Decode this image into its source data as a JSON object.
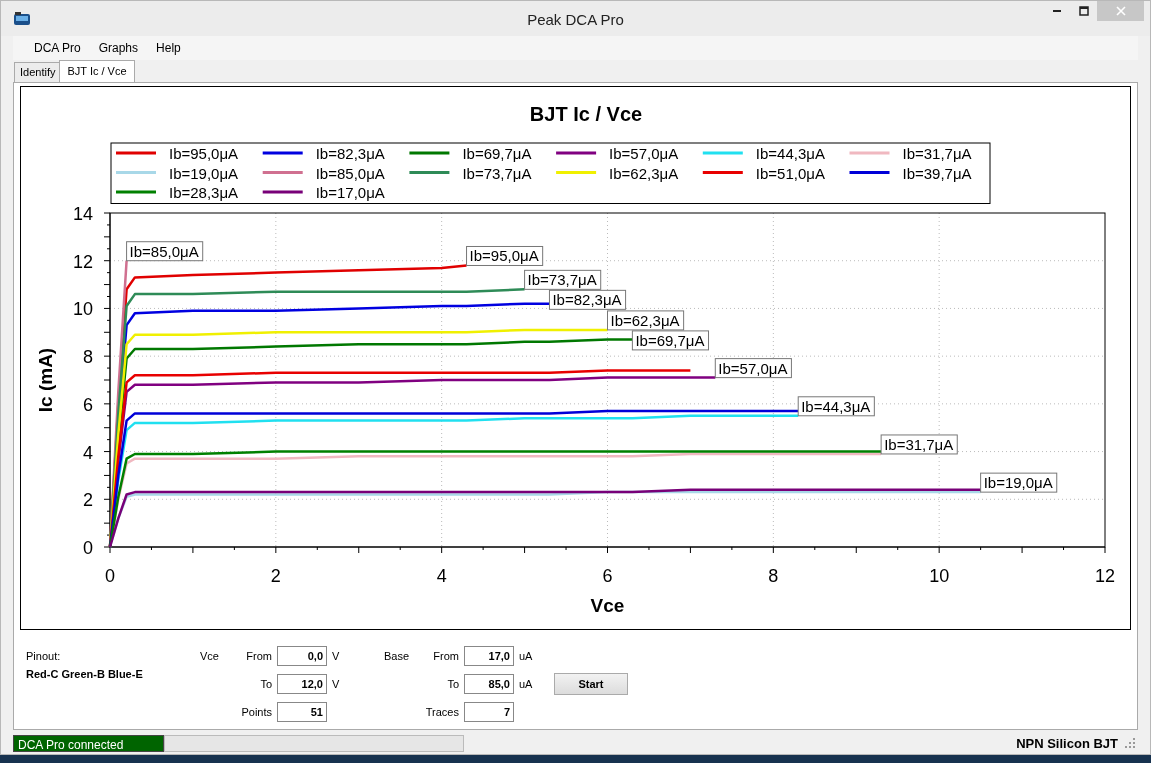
{
  "window": {
    "title": "Peak DCA Pro"
  },
  "menu": [
    "DCA Pro",
    "Graphs",
    "Help"
  ],
  "tabs": [
    {
      "label": "Identify",
      "selected": false
    },
    {
      "label": "BJT Ic / Vce",
      "selected": true
    }
  ],
  "chart": {
    "chart_data": {
      "type": "line",
      "title": "BJT Ic / Vce",
      "xlabel": "Vce",
      "ylabel": "Ic (mA)",
      "x": [
        0,
        0.1,
        0.2,
        0.3,
        1,
        2,
        3,
        4,
        4.3,
        5,
        5.3,
        6,
        6.3,
        7,
        7.3,
        8,
        8.3,
        9,
        9.3,
        10,
        10.5
      ],
      "grid": true,
      "legend": true,
      "xlim": [
        0,
        12
      ],
      "ylim": [
        0,
        14
      ],
      "xticks": [
        0,
        2,
        4,
        6,
        8,
        10,
        12
      ],
      "yticks": [
        0,
        2,
        4,
        6,
        8,
        10,
        12,
        14
      ],
      "series": [
        {
          "name": "Ib=95,0μA",
          "color": "#e00000",
          "values": [
            0,
            6.0,
            10.8,
            11.3,
            11.4,
            11.5,
            11.6,
            11.7,
            11.8,
            null,
            null,
            null,
            null,
            null,
            null,
            null,
            null,
            null,
            null,
            null,
            null
          ]
        },
        {
          "name": "Ib=82,3μA",
          "color": "#0000e0",
          "values": [
            0,
            5.2,
            9.3,
            9.8,
            9.9,
            9.9,
            10.0,
            10.1,
            10.1,
            10.2,
            10.2,
            null,
            null,
            null,
            null,
            null,
            null,
            null,
            null,
            null,
            null
          ]
        },
        {
          "name": "Ib=69,7μA",
          "color": "#007800",
          "values": [
            0,
            4.4,
            7.9,
            8.3,
            8.3,
            8.4,
            8.5,
            8.5,
            8.5,
            8.6,
            8.6,
            8.7,
            8.7,
            null,
            null,
            null,
            null,
            null,
            null,
            null,
            null
          ]
        },
        {
          "name": "Ib=57,0μA",
          "color": "#800080",
          "values": [
            0,
            3.6,
            6.5,
            6.8,
            6.8,
            6.9,
            6.9,
            7.0,
            7.0,
            7.0,
            7.0,
            7.1,
            7.1,
            7.1,
            7.1,
            null,
            null,
            null,
            null,
            null,
            null
          ]
        },
        {
          "name": "Ib=44,3μA",
          "color": "#20e0f0",
          "values": [
            0,
            2.8,
            4.9,
            5.2,
            5.2,
            5.3,
            5.3,
            5.3,
            5.3,
            5.4,
            5.4,
            5.4,
            5.4,
            5.5,
            5.5,
            5.5,
            5.5,
            null,
            null,
            null,
            null
          ]
        },
        {
          "name": "Ib=31,7μA",
          "color": "#f0b8c0",
          "values": [
            0,
            2.0,
            3.5,
            3.7,
            3.7,
            3.7,
            3.8,
            3.8,
            3.8,
            3.8,
            3.8,
            3.8,
            3.8,
            3.9,
            3.9,
            3.9,
            3.9,
            3.9,
            3.9,
            null,
            null
          ]
        },
        {
          "name": "Ib=19,0μA",
          "color": "#a8d8e8",
          "values": [
            0,
            1.2,
            2.1,
            2.2,
            2.2,
            2.2,
            2.2,
            2.2,
            2.2,
            2.2,
            2.2,
            2.3,
            2.3,
            2.3,
            2.3,
            2.3,
            2.3,
            2.3,
            2.3,
            2.3,
            2.3
          ]
        },
        {
          "name": "Ib=85,0μA",
          "color": "#d07090",
          "values": [
            0,
            6.5,
            12.0,
            null,
            null,
            null,
            null,
            null,
            null,
            null,
            null,
            null,
            null,
            null,
            null,
            null,
            null,
            null,
            null,
            null,
            null
          ]
        },
        {
          "name": "Ib=73,7μA",
          "color": "#2e8b57",
          "values": [
            0,
            5.6,
            10.1,
            10.6,
            10.6,
            10.7,
            10.7,
            10.7,
            10.7,
            10.8,
            null,
            null,
            null,
            null,
            null,
            null,
            null,
            null,
            null,
            null,
            null
          ]
        },
        {
          "name": "Ib=62,3μA",
          "color": "#f0f000",
          "values": [
            0,
            4.7,
            8.5,
            8.9,
            8.9,
            9.0,
            9.0,
            9.0,
            9.0,
            9.1,
            9.1,
            9.1,
            null,
            null,
            null,
            null,
            null,
            null,
            null,
            null,
            null
          ]
        },
        {
          "name": "Ib=51,0μA",
          "color": "#e80000",
          "values": [
            0,
            3.8,
            6.9,
            7.2,
            7.2,
            7.3,
            7.3,
            7.3,
            7.3,
            7.3,
            7.3,
            7.4,
            7.4,
            7.4,
            null,
            null,
            null,
            null,
            null,
            null,
            null
          ]
        },
        {
          "name": "Ib=39,7μA",
          "color": "#0000d8",
          "values": [
            0,
            3.0,
            5.3,
            5.6,
            5.6,
            5.6,
            5.6,
            5.6,
            5.6,
            5.6,
            5.6,
            5.7,
            5.7,
            5.7,
            5.7,
            5.7,
            5.7,
            null,
            null,
            null,
            null
          ]
        },
        {
          "name": "Ib=28,3μA",
          "color": "#008000",
          "values": [
            0,
            2.1,
            3.7,
            3.9,
            3.9,
            4.0,
            4.0,
            4.0,
            4.0,
            4.0,
            4.0,
            4.0,
            4.0,
            4.0,
            4.0,
            4.0,
            4.0,
            4.0,
            4.0,
            null,
            null
          ]
        },
        {
          "name": "Ib=17,0μA",
          "color": "#780078",
          "values": [
            0,
            1.2,
            2.2,
            2.3,
            2.3,
            2.3,
            2.3,
            2.3,
            2.3,
            2.3,
            2.3,
            2.3,
            2.3,
            2.4,
            2.4,
            2.4,
            2.4,
            2.4,
            2.4,
            2.4,
            2.4
          ]
        }
      ],
      "annotations": [
        {
          "text": "Ib=85,0μA",
          "x": 0.2,
          "y": 12.0
        },
        {
          "text": "Ib=95,0μA",
          "x": 4.3,
          "y": 11.8
        },
        {
          "text": "Ib=73,7μA",
          "x": 5.0,
          "y": 10.8
        },
        {
          "text": "Ib=82,3μA",
          "x": 5.3,
          "y": 10.2
        },
        {
          "text": "Ib=62,3μA",
          "x": 6.0,
          "y": 9.1
        },
        {
          "text": "Ib=69,7μA",
          "x": 6.3,
          "y": 8.7
        },
        {
          "text": "Ib=57,0μA",
          "x": 7.3,
          "y": 7.1
        },
        {
          "text": "Ib=44,3μA",
          "x": 8.3,
          "y": 5.5
        },
        {
          "text": "Ib=31,7μA",
          "x": 9.3,
          "y": 3.9
        },
        {
          "text": "Ib=19,0μA",
          "x": 10.5,
          "y": 2.3
        }
      ]
    }
  },
  "controls": {
    "pinout_label": "Pinout:",
    "pinout": "Red-C Green-B Blue-E",
    "vce": {
      "label": "Vce",
      "from_label": "From",
      "from": "0,0",
      "from_unit": "V",
      "to_label": "To",
      "to": "12,0",
      "to_unit": "V"
    },
    "base": {
      "label": "Base",
      "from_label": "From",
      "from": "17,0",
      "from_unit": "uA",
      "to_label": "To",
      "to": "85,0",
      "to_unit": "uA"
    },
    "points": {
      "label": "Points",
      "value": "51"
    },
    "traces": {
      "label": "Traces",
      "value": "7"
    },
    "start_button": "Start"
  },
  "status_bar": {
    "connection": "DCA Pro connected",
    "progress": {
      "level": 0
    },
    "device": "NPN Silicon BJT"
  }
}
